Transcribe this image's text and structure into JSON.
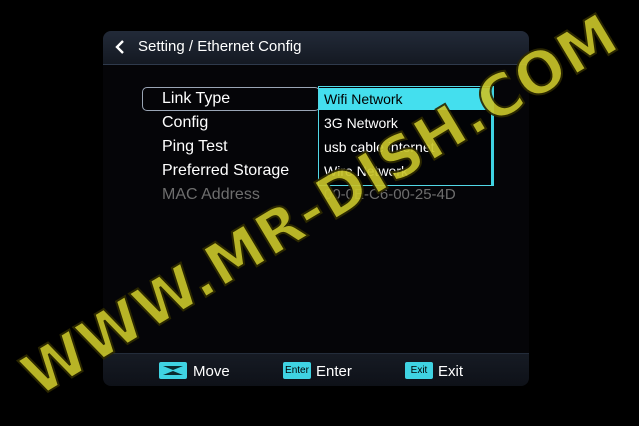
{
  "header": {
    "title": "Setting / Ethernet Config"
  },
  "menu": {
    "items": [
      {
        "label": "Link Type"
      },
      {
        "label": "Config"
      },
      {
        "label": "Ping Test"
      },
      {
        "label": "Preferred Storage"
      },
      {
        "label": "MAC Address"
      }
    ],
    "mac_value": "00-0E-C6-00-25-4D"
  },
  "dropdown": {
    "options": [
      "Wifi Network",
      "3G Network",
      "usb cable internet",
      "Wire Network"
    ],
    "selected": "Wifi Network"
  },
  "footer": {
    "move_label": "Move",
    "enter_badge": "Enter",
    "enter_label": "Enter",
    "exit_badge": "Exit",
    "exit_label": "Exit"
  },
  "watermark": {
    "text": "WWW.MR-DISH.COM"
  },
  "colors": {
    "accent": "#44dfee",
    "watermark": "#c8c42a",
    "disabled_text": "#6e6e6e"
  },
  "icons": {
    "back": "chevron-left-icon",
    "move": "move-arrows-icon"
  }
}
